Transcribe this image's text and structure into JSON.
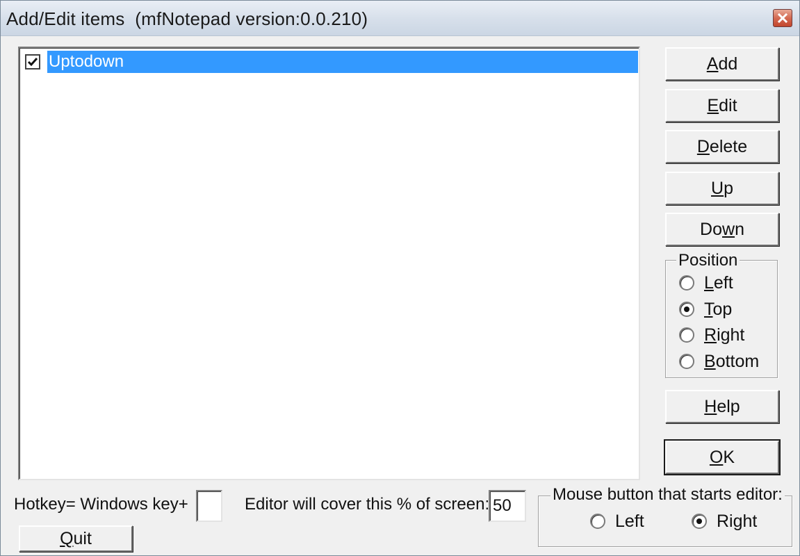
{
  "window": {
    "title": "Add/Edit items  (mfNotepad version:0.0.210)"
  },
  "list": {
    "items": [
      {
        "label": "Uptodown",
        "checked": true,
        "selected": true
      }
    ]
  },
  "buttons": {
    "add": {
      "pre": "",
      "key": "A",
      "post": "dd"
    },
    "edit": {
      "pre": "",
      "key": "E",
      "post": "dit"
    },
    "delete": {
      "pre": "",
      "key": "D",
      "post": "elete"
    },
    "up": {
      "pre": "",
      "key": "U",
      "post": "p"
    },
    "down": {
      "pre": "Do",
      "key": "w",
      "post": "n"
    },
    "help": {
      "pre": "",
      "key": "H",
      "post": "elp"
    },
    "ok": {
      "pre": "",
      "key": "O",
      "post": "K"
    },
    "quit": {
      "pre": "",
      "key": "Q",
      "post": "uit"
    }
  },
  "position_group": {
    "legend": "Position",
    "options": [
      {
        "pre": "",
        "key": "L",
        "post": "eft",
        "selected": false
      },
      {
        "pre": "",
        "key": "T",
        "post": "op",
        "selected": true
      },
      {
        "pre": "",
        "key": "R",
        "post": "ight",
        "selected": false
      },
      {
        "pre": "",
        "key": "B",
        "post": "ottom",
        "selected": false
      }
    ]
  },
  "hotkey": {
    "label": "Hotkey= Windows key+",
    "value": ""
  },
  "cover": {
    "label": "Editor will cover this % of screen:",
    "value": "50"
  },
  "mouse_group": {
    "legend": "Mouse button that starts editor:",
    "options": [
      {
        "label": "Left",
        "selected": false
      },
      {
        "label": "Right",
        "selected": true
      }
    ]
  },
  "colors": {
    "selection": "#3399ff",
    "face": "#f0f0f0"
  }
}
